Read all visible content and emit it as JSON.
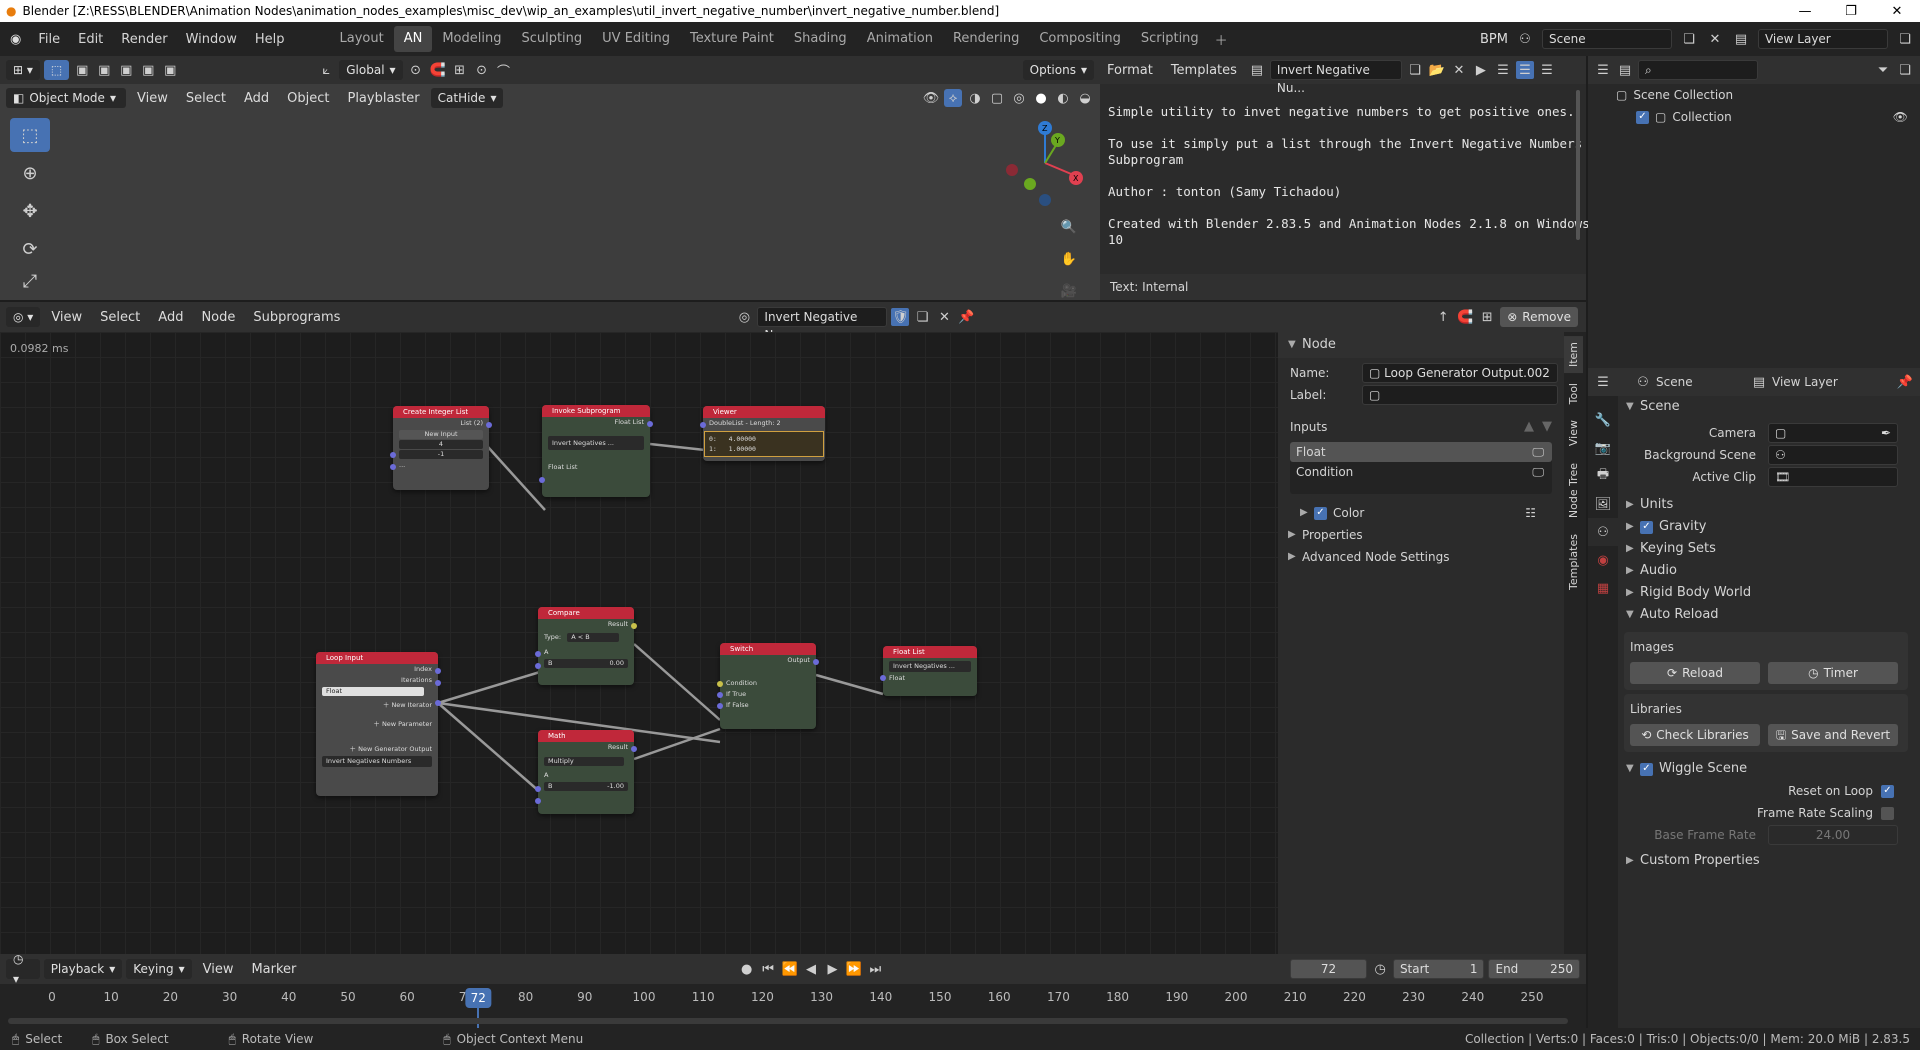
{
  "window": {
    "title": "Blender [Z:\\RESS\\BLENDER\\Animation Nodes\\animation_nodes_examples\\misc_dev\\wip_an_examples\\util_invert_negative_number\\invert_negative_number.blend]"
  },
  "menu": [
    "File",
    "Edit",
    "Render",
    "Window",
    "Help"
  ],
  "workspaces": [
    "Layout",
    "AN",
    "Modeling",
    "Sculpting",
    "UV Editing",
    "Texture Paint",
    "Shading",
    "Animation",
    "Rendering",
    "Compositing",
    "Scripting"
  ],
  "active_workspace": "AN",
  "top_right": {
    "engine": "BPM",
    "scene": "Scene",
    "view_layer": "View Layer"
  },
  "viewport": {
    "orientation": "Global",
    "options": "Options",
    "mode": "Object Mode",
    "menus": [
      "View",
      "Select",
      "Add",
      "Object",
      "Playblaster",
      "CatHide"
    ]
  },
  "text_editor": {
    "menus": [
      "Format",
      "Templates"
    ],
    "text_name": "Invert Negative Nu...",
    "lines": [
      "Simple utility to invet negative numbers to get positive ones.",
      "",
      "To use it simply put a list through the Invert Negative Numbers",
      "Subprogram",
      "",
      "Author : tonton (Samy Tichadou)",
      "",
      "Created with Blender 2.83.5 and Animation Nodes 2.1.8 on Windows",
      "10"
    ],
    "footer": "Text: Internal"
  },
  "outliner": {
    "root": "Scene Collection",
    "child": "Collection"
  },
  "node_editor": {
    "menus": [
      "View",
      "Select",
      "Add",
      "Node",
      "Subprograms"
    ],
    "tree_name": "Invert Negative Nu...",
    "remove": "Remove",
    "timing": "0.0982 ms"
  },
  "nodes": {
    "create_list": {
      "title": "Create Integer List",
      "out": "List (2)",
      "new_input": "New Input",
      "v1": "4",
      "v2": "-1",
      "more": "..."
    },
    "invoke": {
      "title": "Invoke Subprogram",
      "out": "Float List",
      "sub": "Invert Negatives ...",
      "in": "Float List"
    },
    "viewer": {
      "title": "Viewer",
      "info": "DoubleList - Length: 2",
      "l1": "0:   4.00000",
      "l2": "1:   1.00000"
    },
    "loop_input": {
      "title": "Loop Input",
      "index": "Index",
      "iterations": "Iterations",
      "param": "Float",
      "new_iter": "New Iterator",
      "new_param": "New Parameter",
      "new_gen": "New Generator Output",
      "name": "Invert Negatives Numbers"
    },
    "compare": {
      "title": "Compare",
      "out": "Result",
      "type_label": "Type:",
      "type": "A < B",
      "a": "A",
      "b": "B",
      "bval": "0.00"
    },
    "math": {
      "title": "Math",
      "out": "Result",
      "op": "Multiply",
      "a": "A",
      "b": "B",
      "bval": "-1.00"
    },
    "switch": {
      "title": "Switch",
      "out": "Output",
      "cond": "Condition",
      "if_true": "If True",
      "if_false": "If False"
    },
    "float_list": {
      "title": "Float List",
      "sub": "Invert Negatives ...",
      "in": "Float"
    }
  },
  "sidebar": {
    "panel": "Node",
    "name_label": "Name:",
    "name_value": "Loop Generator Output.002",
    "label_label": "Label:",
    "inputs": "Inputs",
    "items": [
      "Float",
      "Condition"
    ],
    "color": "Color",
    "sections": [
      "Properties",
      "Advanced Node Settings"
    ],
    "tabs": [
      "Item",
      "Tool",
      "View",
      "Node Tree",
      "Templates"
    ]
  },
  "properties": {
    "scene_label": "Scene",
    "view_layer": "View Layer",
    "panel": "Scene",
    "camera": "Camera",
    "background_scene": "Background Scene",
    "active_clip": "Active Clip",
    "sections": [
      "Units",
      "Gravity",
      "Keying Sets",
      "Audio",
      "Rigid Body World"
    ],
    "auto_reload": "Auto Reload",
    "images": "Images",
    "reload": "Reload",
    "timer": "Timer",
    "libraries": "Libraries",
    "check_libraries": "Check Libraries",
    "save_revert": "Save and Revert",
    "wiggle": "Wiggle Scene",
    "reset_on_loop": "Reset on Loop",
    "frame_rate_scaling": "Frame Rate Scaling",
    "base_frame_rate": "Base Frame Rate",
    "base_frame_rate_value": "24.00",
    "custom_props": "Custom Properties"
  },
  "timeline": {
    "menus": [
      "Playback",
      "Keying",
      "View",
      "Marker"
    ],
    "current": "72",
    "start_label": "Start",
    "start": "1",
    "end_label": "End",
    "end": "250",
    "ticks": [
      "0",
      "10",
      "20",
      "30",
      "40",
      "50",
      "60",
      "70",
      "80",
      "90",
      "100",
      "110",
      "120",
      "130",
      "140",
      "150",
      "160",
      "170",
      "180",
      "190",
      "200",
      "210",
      "220",
      "230",
      "240",
      "250"
    ]
  },
  "status": {
    "select": "Select",
    "box_select": "Box Select",
    "rotate": "Rotate View",
    "context": "Object Context Menu",
    "info": "Collection | Verts:0 | Faces:0 | Tris:0 | Objects:0/0 | Mem: 20.0 MiB | 2.83.5"
  }
}
